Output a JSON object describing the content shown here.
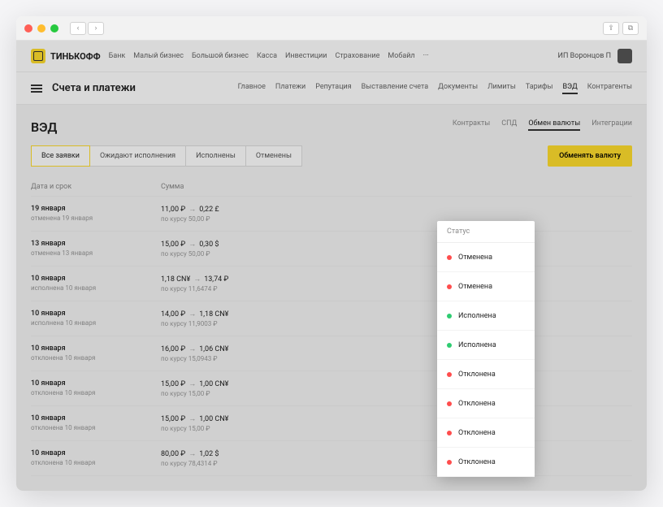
{
  "brand": "ТИНЬКОФФ",
  "topnav": [
    "Банк",
    "Малый бизнес",
    "Большой бизнес",
    "Касса",
    "Инвестиции",
    "Страхование",
    "Мобайл",
    "···"
  ],
  "account_label": "ИП Воронцов П",
  "subtitle": "Счета и платежи",
  "subnav": [
    "Главное",
    "Платежи",
    "Репутация",
    "Выставление счета",
    "Документы",
    "Лимиты",
    "Тарифы",
    "ВЭД",
    "Контрагенты"
  ],
  "subnav_active": "ВЭД",
  "page_title": "ВЭД",
  "page_tabs": [
    "Контракты",
    "СПД",
    "Обмен валюты",
    "Интеграции"
  ],
  "page_tab_active": "Обмен валюты",
  "filters": [
    "Все заявки",
    "Ожидают исполнения",
    "Исполнены",
    "Отменены"
  ],
  "filter_active": "Все заявки",
  "primary_action": "Обменять валюту",
  "columns": {
    "date": "Дата и срок",
    "sum": "Сумма",
    "status": "Статус"
  },
  "rows": [
    {
      "date": "19 января",
      "date_sub": "отменена 19 января",
      "from": "11,00 ₽",
      "to": "0,22 £",
      "rate": "по курсу 50,00 ₽",
      "status": "Отменена",
      "color": "red"
    },
    {
      "date": "13 января",
      "date_sub": "отменена 13 января",
      "from": "15,00 ₽",
      "to": "0,30 $",
      "rate": "по курсу 50,00 ₽",
      "status": "Отменена",
      "color": "red"
    },
    {
      "date": "10 января",
      "date_sub": "исполнена 10 января",
      "from": "1,18 CN¥",
      "to": "13,74 ₽",
      "rate": "по курсу 11,6474 ₽",
      "status": "Исполнена",
      "color": "green"
    },
    {
      "date": "10 января",
      "date_sub": "исполнена 10 января",
      "from": "14,00 ₽",
      "to": "1,18 CN¥",
      "rate": "по курсу 11,9003 ₽",
      "status": "Исполнена",
      "color": "green"
    },
    {
      "date": "10 января",
      "date_sub": "отклонена 10 января",
      "from": "16,00 ₽",
      "to": "1,06 CN¥",
      "rate": "по курсу 15,0943 ₽",
      "status": "Отклонена",
      "color": "red"
    },
    {
      "date": "10 января",
      "date_sub": "отклонена 10 января",
      "from": "15,00 ₽",
      "to": "1,00 CN¥",
      "rate": "по курсу 15,00 ₽",
      "status": "Отклонена",
      "color": "red"
    },
    {
      "date": "10 января",
      "date_sub": "отклонена 10 января",
      "from": "15,00 ₽",
      "to": "1,00 CN¥",
      "rate": "по курсу 15,00 ₽",
      "status": "Отклонена",
      "color": "red"
    },
    {
      "date": "10 января",
      "date_sub": "отклонена 10 января",
      "from": "80,00 ₽",
      "to": "1,02 $",
      "rate": "по курсу 78,4314 ₽",
      "status": "Отклонена",
      "color": "red"
    }
  ]
}
